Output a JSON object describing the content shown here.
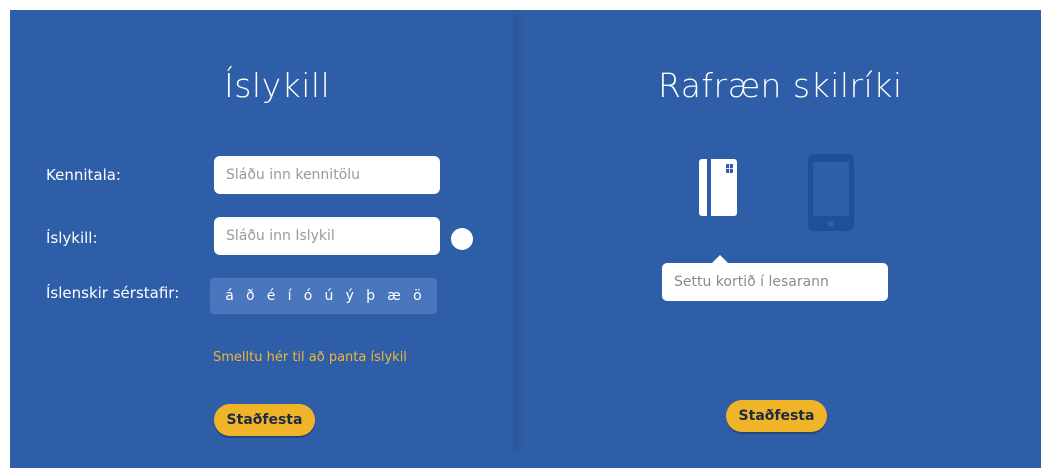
{
  "left_panel": {
    "title": "Íslykill",
    "kennitala_label": "Kennitala:",
    "kennitala_placeholder": "Sláðu inn kennitölu",
    "islykill_label": "Íslykill:",
    "islykill_placeholder": "Sláðu inn Íslykil",
    "special_chars_label": "Íslenskir sérstafir:",
    "special_chars": [
      "á",
      "ð",
      "é",
      "í",
      "ó",
      "ú",
      "ý",
      "þ",
      "æ",
      "ö"
    ],
    "order_link": "Smelltu hér til að panta íslykil",
    "confirm_label": "Staðfesta"
  },
  "right_panel": {
    "title": "Rafræn skilríki",
    "card_icon": "smartcard-icon",
    "phone_icon": "mobile-phone-icon",
    "reader_hint": "Settu kortið í lesarann",
    "confirm_label": "Staðfesta"
  },
  "colors": {
    "background": "#2f5ea9",
    "accent": "#f0b429",
    "link": "#f0b53a",
    "phone": "#1f4f96"
  }
}
